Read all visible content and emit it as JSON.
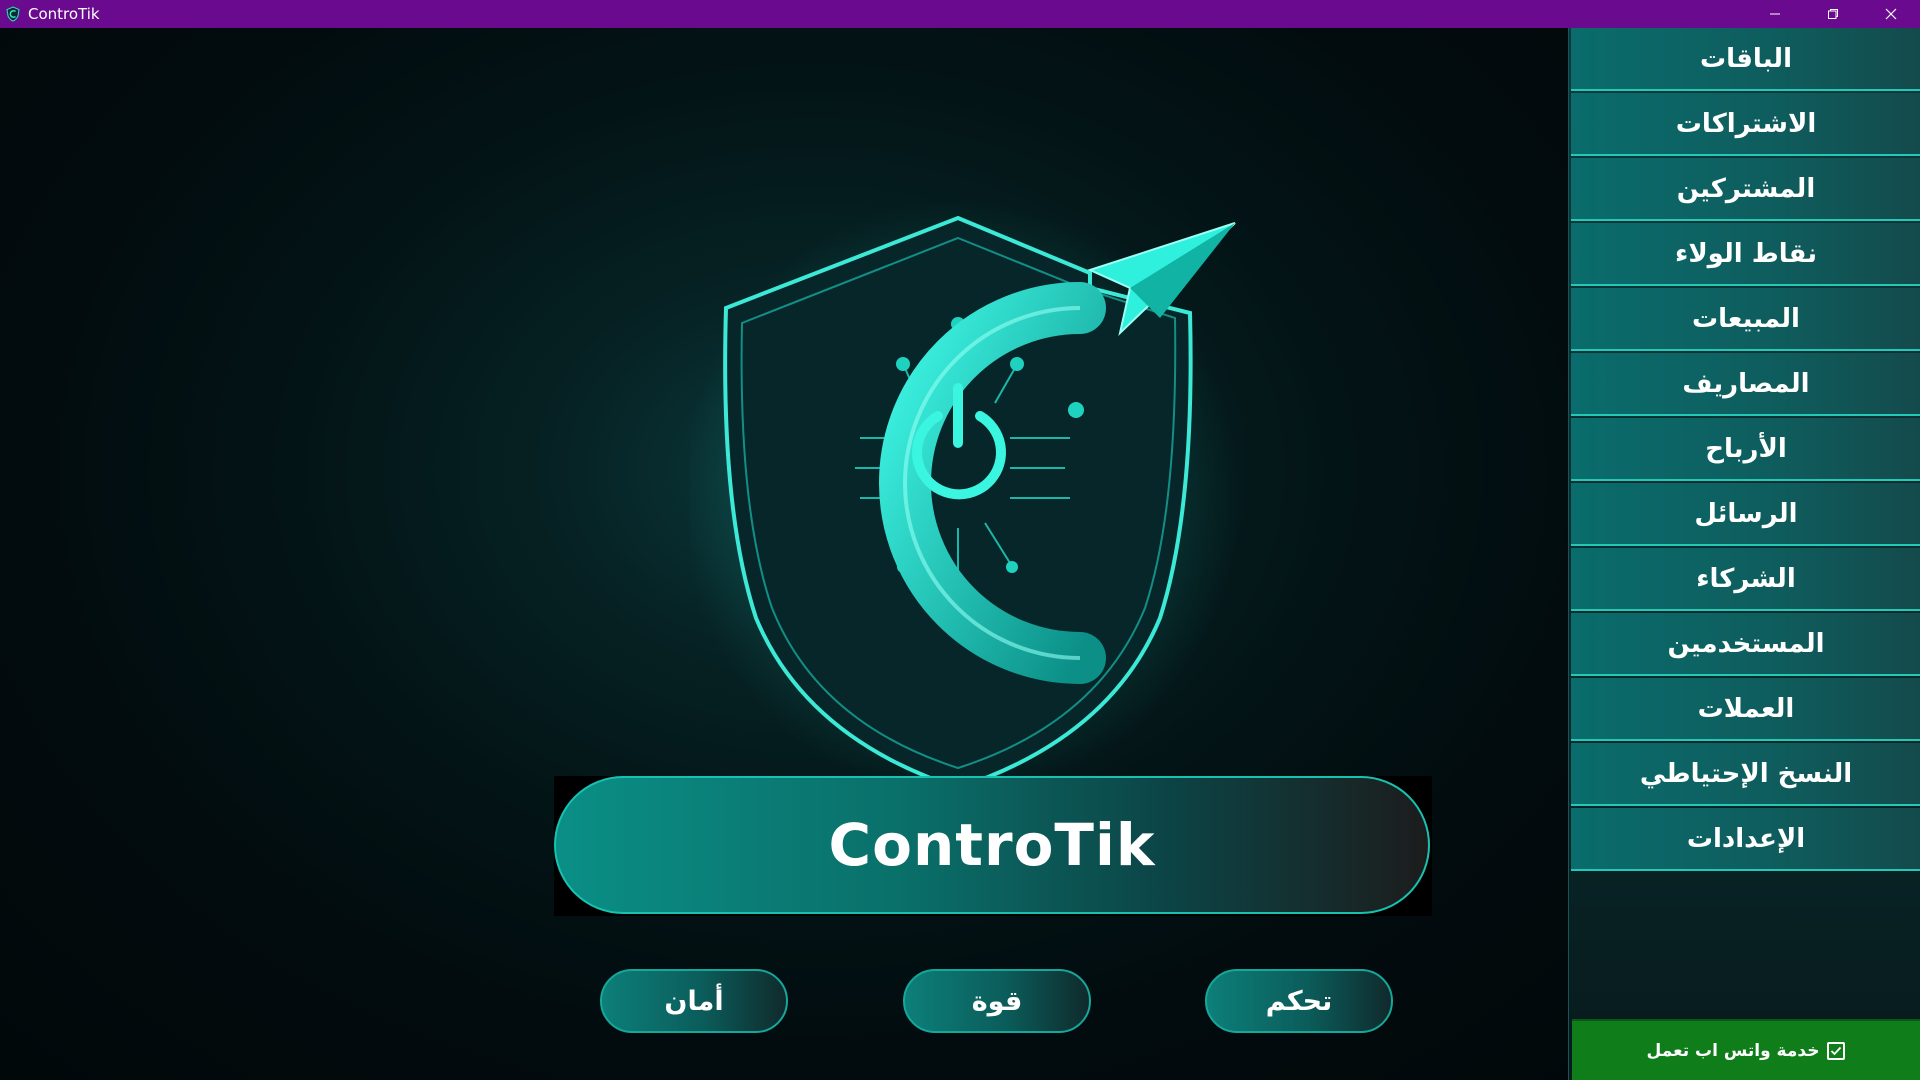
{
  "window": {
    "title": "ControTik",
    "controls": [
      "minimize",
      "restore",
      "close"
    ]
  },
  "main": {
    "brand_name": "ControTik",
    "tags": [
      {
        "label": "تحكم"
      },
      {
        "label": "قوة"
      },
      {
        "label": "أمان"
      }
    ]
  },
  "sidebar": {
    "items": [
      {
        "label": "الباقات"
      },
      {
        "label": "الاشتراكات"
      },
      {
        "label": "المشتركين"
      },
      {
        "label": "نقاط الولاء"
      },
      {
        "label": "المبيعات"
      },
      {
        "label": "المصاريف"
      },
      {
        "label": "الأرباح"
      },
      {
        "label": "الرسائل"
      },
      {
        "label": "الشركاء"
      },
      {
        "label": "المستخدمين"
      },
      {
        "label": "العملات"
      },
      {
        "label": "النسخ الإحتياطي"
      },
      {
        "label": "الإعدادات"
      }
    ]
  },
  "whatsapp": {
    "label": "خدمة واتس اب تعمل",
    "checked": true
  },
  "colors": {
    "titlebar": "#6a0a8e",
    "accent": "#21c9b6",
    "whatsapp_ok": "#0e7d1a"
  }
}
